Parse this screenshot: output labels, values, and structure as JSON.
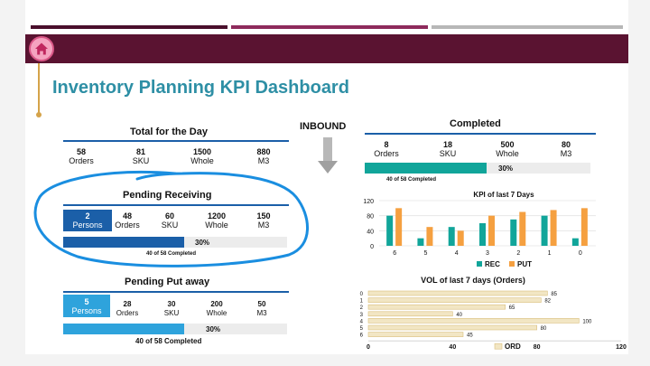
{
  "page_title": "Inventory Planning KPI Dashboard",
  "home_icon": "home-icon",
  "colors": {
    "banner": "#5a1331",
    "title": "#2e8fa5",
    "rule_blue": "#1b5fa8",
    "persons_light": "#2ea3dc",
    "completed_fill": "#11a59a",
    "rec": "#11a59a",
    "put": "#f5a040",
    "ord_fill": "#f2e6c4",
    "ord_stroke": "#d9be7c",
    "annotation": "#1a8ee0"
  },
  "total_day": {
    "title": "Total for the Day",
    "stats": [
      {
        "value": "58",
        "label": "Orders"
      },
      {
        "value": "81",
        "label": "SKU"
      },
      {
        "value": "1500",
        "label": "Whole"
      },
      {
        "value": "880",
        "label": "M3"
      }
    ]
  },
  "inbound": {
    "label": "INBOUND",
    "icon": "arrow-down-icon"
  },
  "pending_receiving": {
    "title": "Pending Receiving",
    "persons": {
      "value": "2",
      "label": "Persons"
    },
    "stats": [
      {
        "value": "48",
        "label": "Orders"
      },
      {
        "value": "60",
        "label": "SKU"
      },
      {
        "value": "1200",
        "label": "Whole"
      },
      {
        "value": "150",
        "label": "M3"
      }
    ],
    "progress_fraction": 0.3,
    "progress_text": "30%",
    "caption": "40 of 58 Completed"
  },
  "pending_putaway": {
    "title": "Pending Put away",
    "persons": {
      "value": "5",
      "label": "Persons"
    },
    "stats": [
      {
        "value": "28",
        "label": "Orders"
      },
      {
        "value": "30",
        "label": "SKU"
      },
      {
        "value": "200",
        "label": "Whole"
      },
      {
        "value": "50",
        "label": "M3"
      }
    ],
    "progress_fraction": 0.3,
    "progress_text": "30%",
    "caption": "40 of 58 Completed"
  },
  "completed": {
    "title": "Completed",
    "stats": [
      {
        "value": "8",
        "label": "Orders"
      },
      {
        "value": "18",
        "label": "SKU"
      },
      {
        "value": "500",
        "label": "Whole"
      },
      {
        "value": "80",
        "label": "M3"
      }
    ],
    "progress_fraction": 0.3,
    "progress_text": "30%",
    "caption": "40 of 58 Completed"
  },
  "chart_data": [
    {
      "type": "bar",
      "title": "KPI of last 7 Days",
      "categories": [
        "6",
        "5",
        "4",
        "3",
        "2",
        "1",
        "0"
      ],
      "series": [
        {
          "name": "REC",
          "values": [
            80,
            20,
            50,
            60,
            70,
            80,
            20
          ]
        },
        {
          "name": "PUT",
          "values": [
            100,
            50,
            40,
            80,
            90,
            95,
            100
          ]
        }
      ],
      "ylim": [
        0,
        120
      ],
      "yticks": [
        "0",
        "40",
        "80",
        "120"
      ],
      "legend": "bottom"
    },
    {
      "type": "bar",
      "orientation": "horizontal",
      "title": "VOL of last 7 days (Orders)",
      "categories": [
        "0",
        "1",
        "2",
        "3",
        "4",
        "5",
        "6"
      ],
      "series": [
        {
          "name": "ORD",
          "values": [
            85,
            82,
            65,
            40,
            100,
            80,
            45
          ]
        }
      ],
      "xlim": [
        0,
        120
      ],
      "xticks": [
        "0",
        "40",
        "80",
        "120"
      ],
      "legend": "bottom"
    }
  ]
}
